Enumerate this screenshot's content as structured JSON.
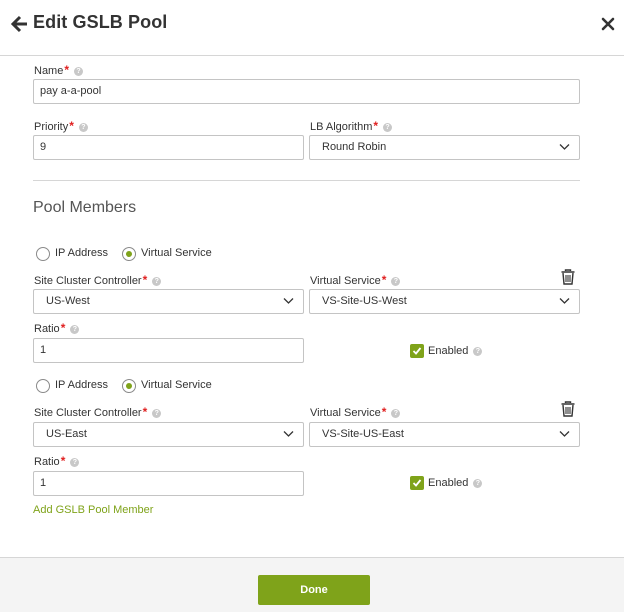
{
  "modal": {
    "title": "Edit GSLB Pool",
    "back_icon": "arrow-left-icon",
    "close_icon": "close-icon"
  },
  "form": {
    "name_label": "Name",
    "name_value": "pay a-a-pool",
    "priority_label": "Priority",
    "priority_value": "9",
    "algorithm_label": "LB Algorithm",
    "algorithm_value": "Round Robin"
  },
  "pool_members": {
    "section_title": "Pool Members",
    "ip_address_label": "IP Address",
    "virtual_service_radio_label": "Virtual Service",
    "site_cluster_label": "Site Cluster Controller",
    "virtual_service_label": "Virtual Service",
    "ratio_label": "Ratio",
    "enabled_label": "Enabled",
    "members": [
      {
        "selected_type": "Virtual Service",
        "site_cluster": "US-West",
        "virtual_service": "VS-Site-US-West",
        "ratio": "1",
        "enabled": true
      },
      {
        "selected_type": "Virtual Service",
        "site_cluster": "US-East",
        "virtual_service": "VS-Site-US-East",
        "ratio": "1",
        "enabled": true
      }
    ],
    "add_member_label": "Add GSLB Pool Member"
  },
  "footer": {
    "done_label": "Done"
  },
  "colors": {
    "accent": "#7fa31a",
    "required": "#e02020",
    "border": "#c4c4c4"
  }
}
